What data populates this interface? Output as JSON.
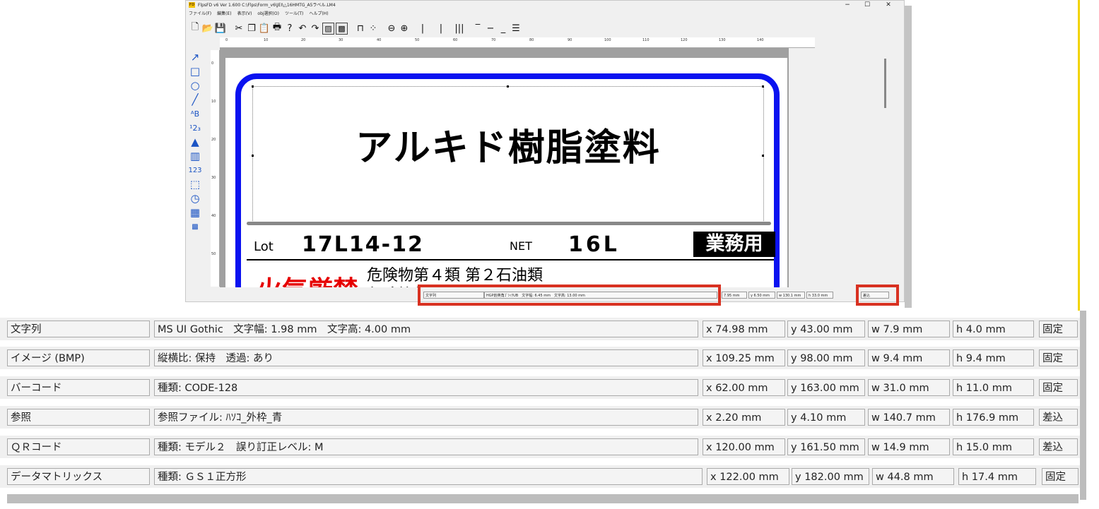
{
  "window": {
    "title": "FlpsFD v6  Ver 1.600  C:\\Flps\\Form_v6\\JEI\\△16HMTG_A5ラベル.LM4",
    "logo_text": "FD",
    "minimize": "−",
    "maximize": "☐",
    "close": "✕"
  },
  "menu": [
    "ファイル(F)",
    "編集(E)",
    "表示(V)",
    "obj選択(O)",
    "ツール(T)",
    "ヘルプ(H)"
  ],
  "ruler_top": [
    "0",
    "10",
    "20",
    "30",
    "40",
    "50",
    "60",
    "70",
    "80",
    "90",
    "100",
    "110",
    "120",
    "130",
    "140"
  ],
  "ruler_left": [
    "0",
    "10",
    "20",
    "30",
    "40",
    "50"
  ],
  "label": {
    "product_title": "アルキド樹脂塗料",
    "lot_label": "Lot",
    "lot_value": "17L14-12",
    "net_label": "NET",
    "net_value": "16L",
    "business_badge": "業務用",
    "fire_warning": "火気厳禁",
    "danger_line1": "危険物第４類 第２石油類",
    "danger_line2": "危険等級Ⅲ 非水溶性液体"
  },
  "statusbar": {
    "type": "文字列",
    "font_info": "HGP創英角ｺﾞｼｯｸUB　文字幅: 6.45 mm　文字高: 13.00 mm",
    "x": "7.95 mm",
    "y": "y 6.50 mm",
    "w": "w 130.1 mm",
    "h": "h 33.0 mm",
    "mode": "差込"
  },
  "rows": [
    {
      "type": "文字列",
      "detail": "MS UI Gothic　文字幅: 1.98 mm　文字高: 4.00 mm",
      "x": "x 74.98 mm",
      "y": "y 43.00 mm",
      "w": "w  7.9 mm",
      "h": "h  4.0 mm",
      "mode": "固定"
    },
    {
      "type": "イメージ (BMP)",
      "detail": "縦横比: 保持　透過: あり",
      "x": "x 109.25 mm",
      "y": "y 98.00 mm",
      "w": "w  9.4 mm",
      "h": "h  9.4 mm",
      "mode": "固定"
    },
    {
      "type": "バーコード",
      "detail": "種類: CODE-128",
      "x": "x 62.00 mm",
      "y": "y 163.00 mm",
      "w": "w 31.0 mm",
      "h": "h 11.0 mm",
      "mode": "固定"
    },
    {
      "type": "参照",
      "detail": "参照ファイル: ﾊｿｺ_外枠_青",
      "x": "x  2.20 mm",
      "y": "y  4.10 mm",
      "w": "w 140.7 mm",
      "h": "h 176.9 mm",
      "mode": "差込"
    },
    {
      "type": "ＱＲコード",
      "detail": "種類: モデル２　誤り訂正レベル: M",
      "x": "x 120.00 mm",
      "y": "y 161.50 mm",
      "w": "w 14.9 mm",
      "h": "h 15.0 mm",
      "mode": "差込"
    },
    {
      "type": "データマトリックス",
      "detail": "種類: ＧＳ１正方形",
      "x": "x 122.00 mm",
      "y": "y 182.00 mm",
      "w": "w 44.8 mm",
      "h": "h 17.4 mm",
      "mode": "固定"
    }
  ],
  "colors": {
    "frame_blue": "#0a12f0",
    "highlight_red": "#d83121",
    "fire_red": "#e60000"
  }
}
